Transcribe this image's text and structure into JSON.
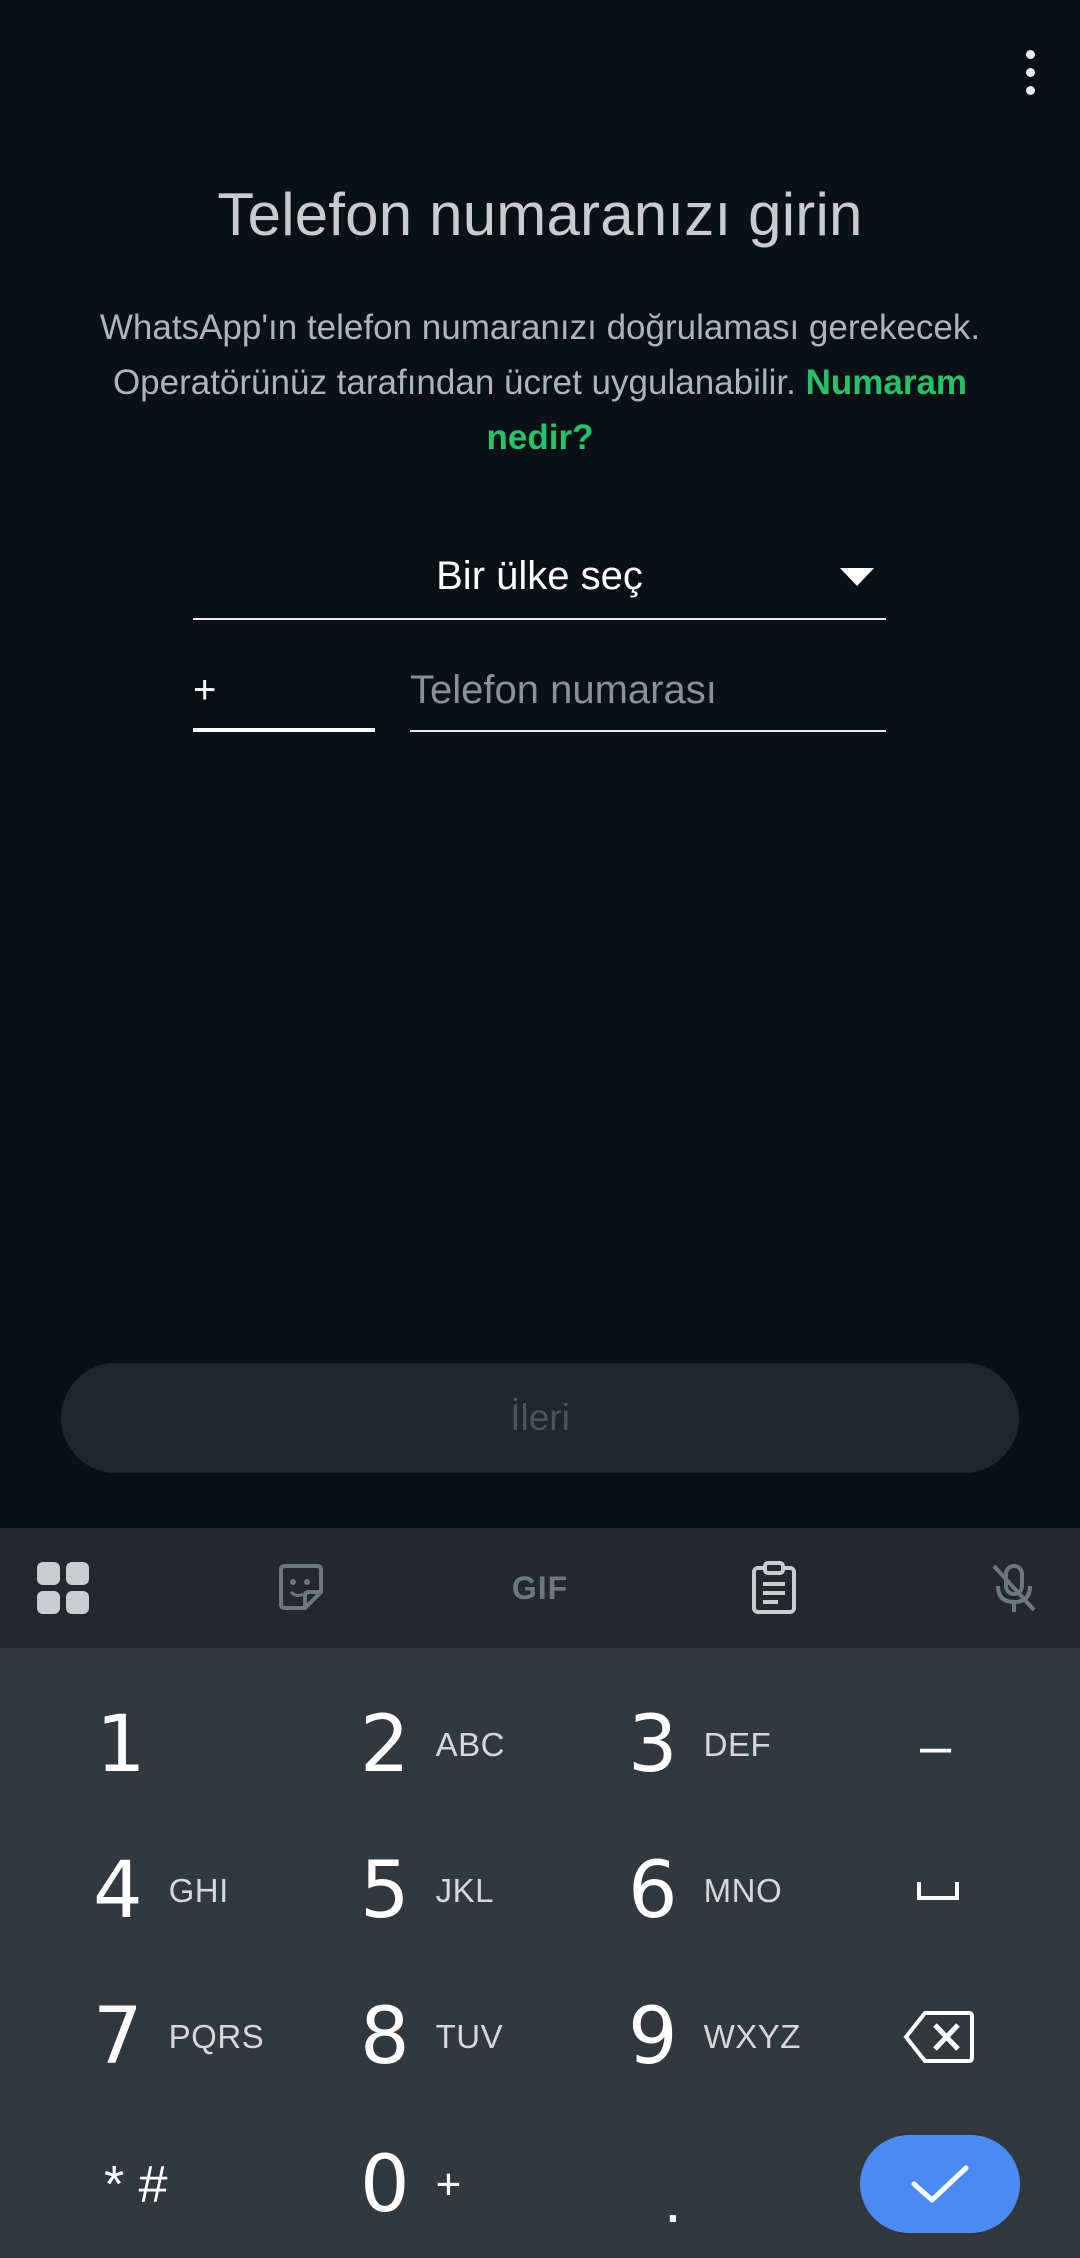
{
  "header": {
    "title": "Telefon numaranızı girin",
    "description": "WhatsApp'ın telefon numaranızı doğrulaması gerekecek. Operatörünüz tarafından ücret uygulanabilir.",
    "link_text": "Numaram nedir?"
  },
  "form": {
    "country_label": "Bir ülke seç",
    "code_prefix": "+",
    "phone_placeholder": "Telefon numarası"
  },
  "next_button": "İleri",
  "keyboard": {
    "toolbar": {
      "gif_label": "GIF"
    },
    "keys": [
      {
        "digit": "1",
        "letters": ""
      },
      {
        "digit": "2",
        "letters": "ABC"
      },
      {
        "digit": "3",
        "letters": "DEF"
      },
      {
        "digit": "4",
        "letters": "GHI"
      },
      {
        "digit": "5",
        "letters": "JKL"
      },
      {
        "digit": "6",
        "letters": "MNO"
      },
      {
        "digit": "7",
        "letters": "PQRS"
      },
      {
        "digit": "8",
        "letters": "TUV"
      },
      {
        "digit": "9",
        "letters": "WXYZ"
      },
      {
        "digit": "0",
        "letters": "+"
      }
    ],
    "symbols": {
      "minus": "–",
      "star_hash": "* #",
      "dot": "."
    }
  },
  "colors": {
    "background": "#0b1014",
    "accent_green": "#25c26a",
    "done_blue": "#4a8bf2"
  }
}
